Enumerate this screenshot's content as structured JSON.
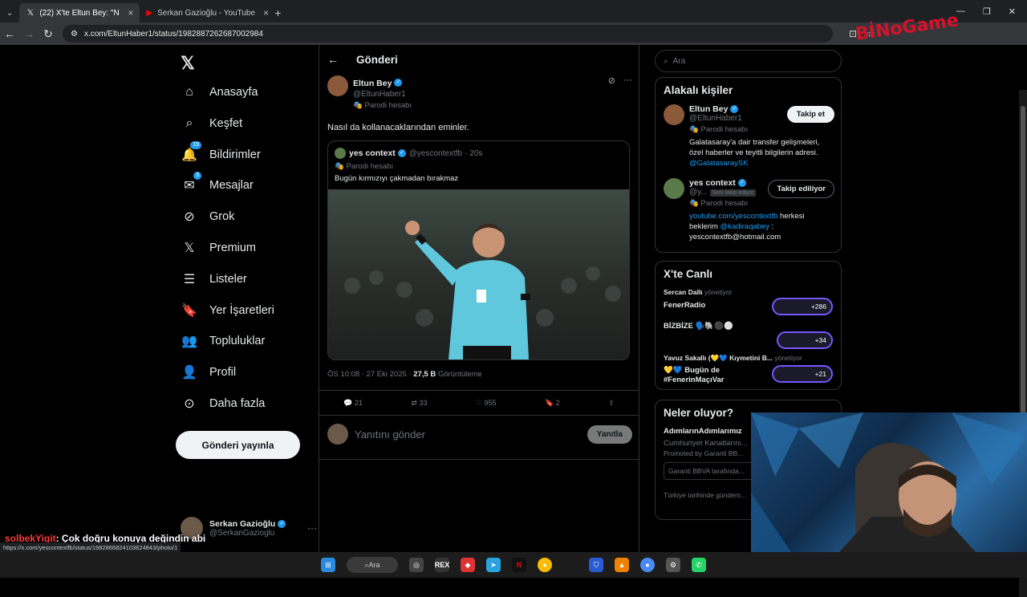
{
  "browser": {
    "tabs": [
      {
        "label": "(22) X'te Eltun Bey: \"Nasıl da k...",
        "icon": "x-icon"
      },
      {
        "label": "Serkan Gazioğlu - YouTube",
        "icon": "youtube-icon"
      }
    ],
    "new_tab": "+",
    "url": "x.com/EltunHaber1/status/1982887262687002984",
    "status_url": "https://x.com/yescontextfb/status/1982866824103624843/photo/1"
  },
  "nav": {
    "items": [
      {
        "label": "Anasayfa",
        "icon": "home-icon"
      },
      {
        "label": "Keşfet",
        "icon": "search-icon"
      },
      {
        "label": "Bildirimler",
        "icon": "bell-icon",
        "badge": "19"
      },
      {
        "label": "Mesajlar",
        "icon": "mail-icon",
        "badge": "3"
      },
      {
        "label": "Grok",
        "icon": "grok-icon"
      },
      {
        "label": "Premium",
        "icon": "x-premium-icon"
      },
      {
        "label": "Listeler",
        "icon": "list-icon"
      },
      {
        "label": "Yer İşaretleri",
        "icon": "bookmark-icon"
      },
      {
        "label": "Topluluklar",
        "icon": "communities-icon"
      },
      {
        "label": "Profil",
        "icon": "profile-icon"
      },
      {
        "label": "Daha fazla",
        "icon": "more-circle-icon"
      }
    ],
    "post_button": "Gönderi yayınla",
    "account": {
      "name": "Serkan Gazioğlu",
      "handle": "@SerkanGazioglu"
    }
  },
  "main": {
    "title": "Gönderi",
    "tweet": {
      "author": "Eltun Bey",
      "handle": "@EltunHaber1",
      "parody": "Parodi hesabı",
      "text": "Nasıl da kollanacaklarından eminler.",
      "quote": {
        "author": "yes context",
        "handle": "@yescontextfb",
        "time": "20s",
        "parody": "Parodi hesabı",
        "text": "Bugün kırmızıyı çakmadan bırakmaz"
      },
      "time": "ÖS 10:08 · 27 Eki 2025 ·",
      "views": "27,5 B",
      "views_label": "Görüntüleme",
      "replies": "21",
      "retweets": "33",
      "likes": "955",
      "bookmarks": "2"
    },
    "reply_placeholder": "Yanıtını gönder",
    "reply_button": "Yanıtla"
  },
  "right": {
    "search_placeholder": "Ara",
    "relevant_title": "Alakalı kişiler",
    "people": [
      {
        "name": "Eltun Bey",
        "handle": "@EltunHaber1",
        "parody": "Parodi hesabı",
        "button": "Takip et",
        "bio": "Galatasaray'a dair transfer gelişmeleri, özel haberler ve teyitli bilgilerin adresi.",
        "bio_link": "@GalatasaraySK"
      },
      {
        "name": "yes context",
        "handle": "@y...",
        "follows_you": "Seni takip ediyor",
        "parody": "Parodi hesabı",
        "button": "Takip ediliyor",
        "bio_link1": "youtube.com/yescontextfb",
        "bio_mid": " herkesi beklerim ",
        "bio_link2": "@kadiraqabey",
        "bio_end": " : yescontextfb@hotmail.com"
      }
    ],
    "live_title": "X'te Canlı",
    "live": [
      {
        "host": "Sercan Dallı",
        "role": "yönetiyor",
        "title": "FenerRadio",
        "count": "+286"
      },
      {
        "host": "",
        "role": "",
        "title": "BİZBİZE 🗣️🐘⚫⚪",
        "count": "+34"
      },
      {
        "host": "Yavuz Sakallı (💛💙 Kıymetini B...",
        "role": "yönetiyor",
        "title": "💛💙 Bugün de #FenerinMaçıVar",
        "count": "+21"
      }
    ],
    "trends_title": "Neler oluyor?",
    "trends": [
      {
        "title": "AdımlarınAdımlarımız",
        "sub": "Cumhuriyet Kanatlarını...",
        "promo": "Promoted by Garanti BB..."
      }
    ],
    "promo_input": "Garanti BBVA tarafında...",
    "trend_footer": "Türkiye tarihinde gündem..."
  },
  "overlay": {
    "logo": "BİNoGame",
    "chat_user": "solbekYigit",
    "chat_text": ": Çok doğru konuya değindin abi"
  },
  "taskbar": {
    "search": "Ara"
  }
}
